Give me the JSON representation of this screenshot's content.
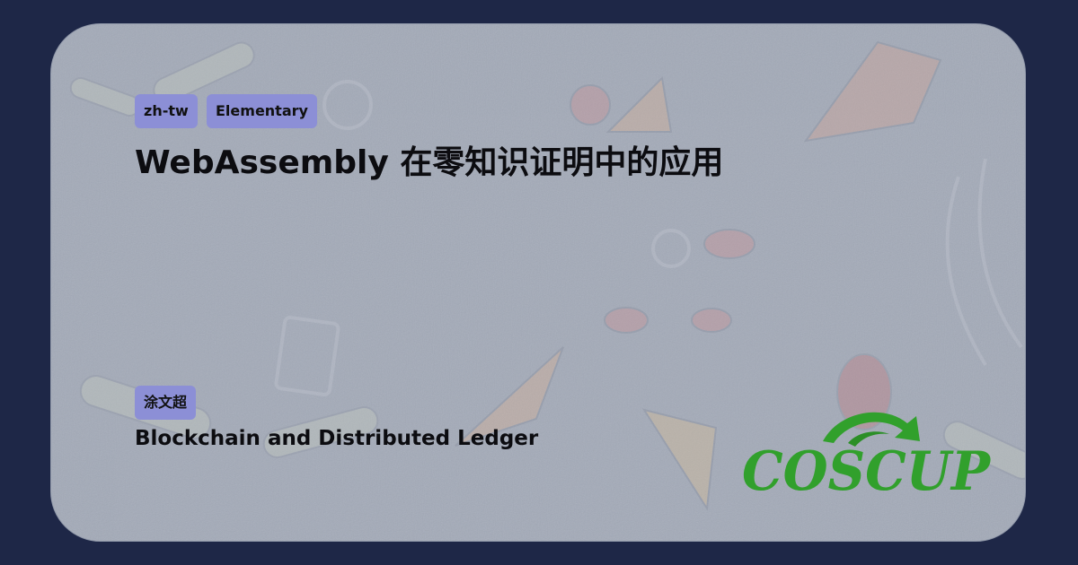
{
  "tags": {
    "language": "zh-tw",
    "level": "Elementary",
    "speaker": "涂文超"
  },
  "talk": {
    "title": "WebAssembly 在零知识证明中的应用",
    "track": "Blockchain and Distributed Ledger"
  },
  "brand": {
    "logo_text": "COSCUP",
    "logo_color": "#31a02c",
    "chip_color": "#8c8fd6",
    "card_color": "#a3aab8",
    "page_background": "#1e2747"
  }
}
